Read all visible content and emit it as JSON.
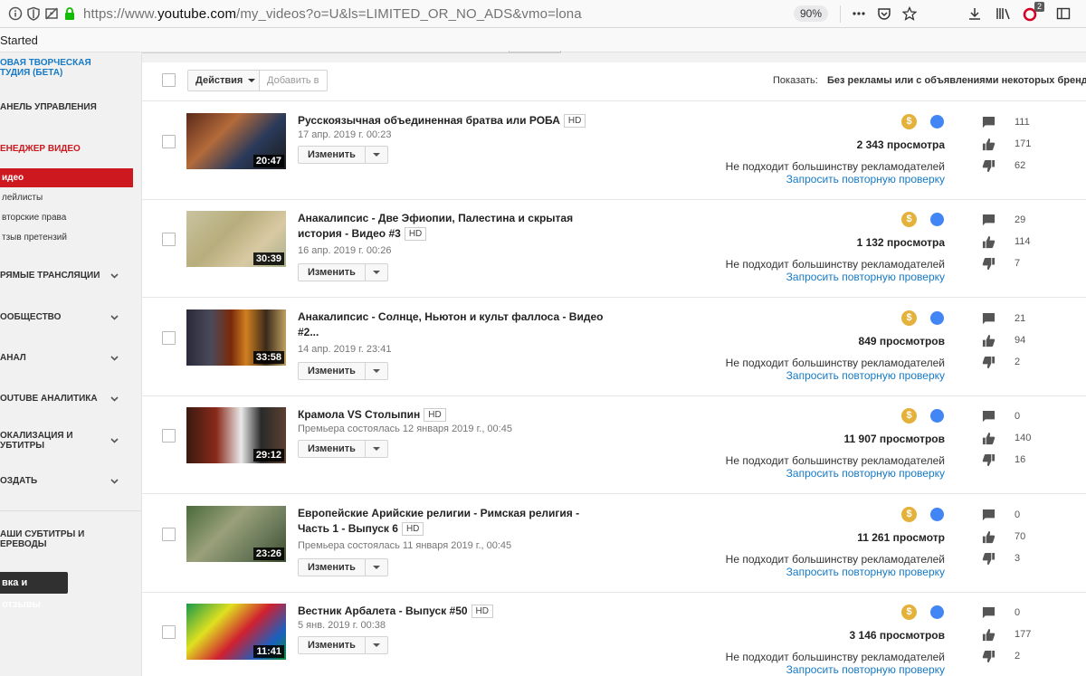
{
  "browser": {
    "url_prefix": "https://www.",
    "url_domain": "youtube.com",
    "url_path": "/my_videos?o=U&ls=LIMITED_OR_NO_ADS&vmo=lona",
    "zoom": "90%",
    "badge_count": "2",
    "bookmark_text": "Started"
  },
  "sidebar": {
    "studio_line1": "ОВАЯ ТВОРЧЕСКАЯ",
    "studio_line2": "ТУДИЯ (БЕТА)",
    "dashboard": "АНЕЛЬ УПРАВЛЕНИЯ",
    "video_manager": "ЕНЕДЖЕР ВИДЕО",
    "sub_videos": "идео",
    "sub_playlists": "лейлисты",
    "sub_copyright": "вторские права",
    "sub_claims": "тзыв претензий",
    "live": "РЯМЫЕ ТРАНСЛЯЦИИ",
    "community": "ООБЩЕСТВО",
    "channel": "АНАЛ",
    "analytics": "OUTUBE АНАЛИТИКА",
    "localization_line1": "ОКАЛИЗАЦИЯ И",
    "localization_line2": "УБТИТРЫ",
    "create": "ОЗДАТЬ",
    "your_subs_line1": "АШИ СУБТИТРЫ И",
    "your_subs_line2": "ЕРЕВОДЫ",
    "feedback": "вка и отзывы"
  },
  "toolbar": {
    "actions_label": "Действия",
    "add_to_label": "Добавить в",
    "show_label": "Показать:",
    "show_value": "Без рекламы или с объявлениями некоторых брендов"
  },
  "colors": {
    "monetization": "#e4b13a",
    "public": "#4285f4",
    "active_nav": "#cc181e",
    "link": "#167ac6"
  },
  "icons": [
    "monetization-dollar-icon",
    "public-globe-icon",
    "comment-icon",
    "thumbs-up-icon",
    "thumbs-down-icon"
  ],
  "videos": [
    {
      "title": "Русскоязычная объединенная братва или РОБА",
      "hd": "HD",
      "date": "17 апр. 2019 г. 00:23",
      "duration": "20:47",
      "edit": "Изменить",
      "views": "2 343 просмотра",
      "ads_status": "Не подходит большинству рекламодателей",
      "recheck": "Запросить повторную проверку",
      "comments": "111",
      "likes": "171",
      "dislikes": "62"
    },
    {
      "title": "Анакалипсис - Две Эфиопии, Палестина и скрытая история - Видео #3",
      "hd": "HD",
      "date": "16 апр. 2019 г. 00:26",
      "duration": "30:39",
      "edit": "Изменить",
      "views": "1 132 просмотра",
      "ads_status": "Не подходит большинству рекламодателей",
      "recheck": "Запросить повторную проверку",
      "comments": "29",
      "likes": "114",
      "dislikes": "7"
    },
    {
      "title": "Анакалипсис - Солнце, Ньютон и культ фаллоса - Видео #2...",
      "hd": "",
      "date": "14 апр. 2019 г. 23:41",
      "duration": "33:58",
      "edit": "Изменить",
      "views": "849 просмотров",
      "ads_status": "Не подходит большинству рекламодателей",
      "recheck": "Запросить повторную проверку",
      "comments": "21",
      "likes": "94",
      "dislikes": "2"
    },
    {
      "title": "Крамола VS Столыпин",
      "hd": "HD",
      "date": "Премьера состоялась 12 января 2019 г., 00:45",
      "duration": "29:12",
      "edit": "Изменить",
      "views": "11 907 просмотров",
      "ads_status": "Не подходит большинству рекламодателей",
      "recheck": "Запросить повторную проверку",
      "comments": "0",
      "likes": "140",
      "dislikes": "16"
    },
    {
      "title": "Европейские Арийские религии - Римская религия - Часть 1 - Выпуск 6",
      "hd": "HD",
      "date": "Премьера состоялась 11 января 2019 г., 00:45",
      "duration": "23:26",
      "edit": "Изменить",
      "views": "11 261 просмотр",
      "ads_status": "Не подходит большинству рекламодателей",
      "recheck": "Запросить повторную проверку",
      "comments": "0",
      "likes": "70",
      "dislikes": "3"
    },
    {
      "title": "Вестник Арбалета - Выпуск #50",
      "hd": "HD",
      "date": "5 янв. 2019 г. 00:38",
      "duration": "11:41",
      "edit": "Изменить",
      "views": "3 146 просмотров",
      "ads_status": "Не подходит большинству рекламодателей",
      "recheck": "Запросить повторную проверку",
      "comments": "0",
      "likes": "177",
      "dislikes": "2"
    }
  ]
}
